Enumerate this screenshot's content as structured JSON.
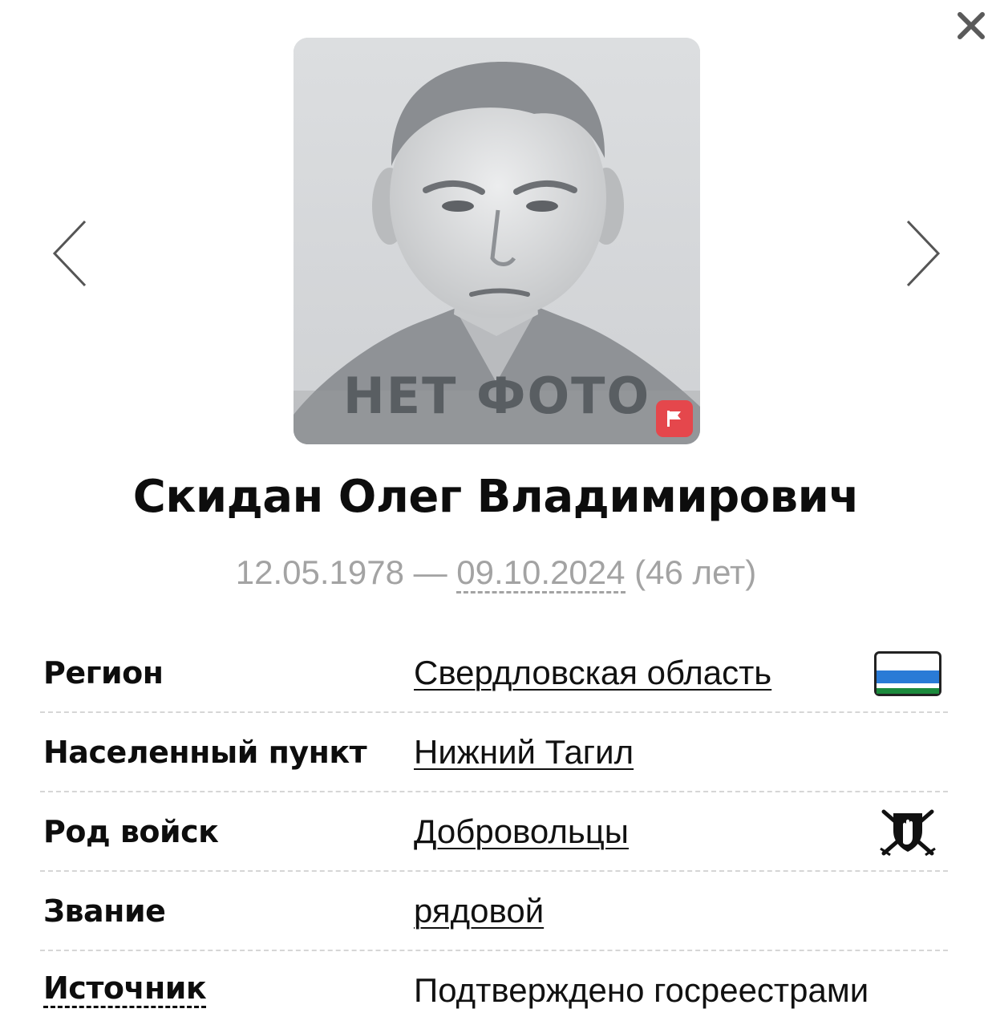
{
  "photo": {
    "placeholder_text": "НЕТ ФОТО",
    "report_icon": "flag-icon"
  },
  "icons": {
    "close": "close-icon",
    "prev": "chevron-left-icon",
    "next": "chevron-right-icon",
    "region_flag": "sverdlovsk-flag-icon",
    "troops_emblem": "volunteer-shield-icon"
  },
  "person": {
    "name": "Скидан Олег Владимирович",
    "birth_date": "12.05.1978",
    "separator": " — ",
    "death_date": "09.10.2024",
    "age": " (46 лет)"
  },
  "info": {
    "region": {
      "label": "Регион",
      "value": "Свердловская область"
    },
    "locality": {
      "label": "Населенный пункт",
      "value": "Нижний Тагил"
    },
    "troops": {
      "label": "Род войск",
      "value": "Добровольцы"
    },
    "rank": {
      "label": "Звание",
      "value": "рядовой"
    },
    "source": {
      "label": "Источник",
      "value": "Подтверждено госреестрами"
    }
  },
  "colors": {
    "flag_white": "#ffffff",
    "flag_blue": "#2a7bd6",
    "flag_green": "#1b8a3c",
    "report_red": "#e5474c",
    "muted_text": "#a3a3a3"
  }
}
